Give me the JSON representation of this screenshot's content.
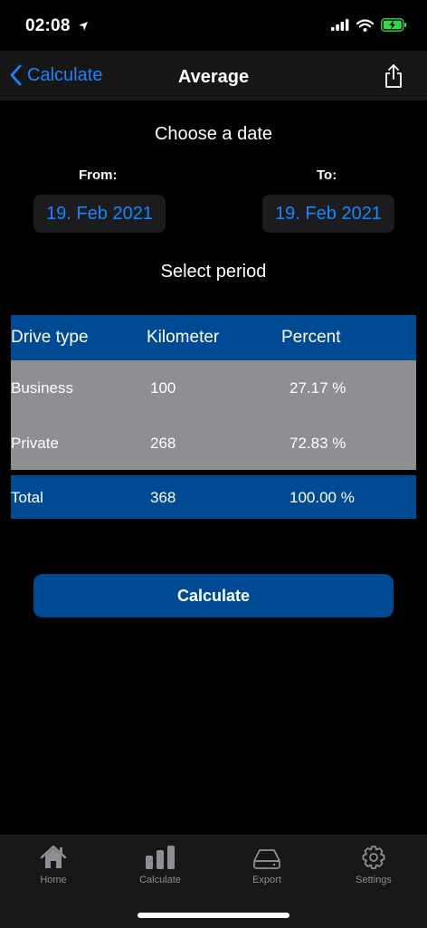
{
  "status": {
    "time": "02:08"
  },
  "nav": {
    "back_label": "Calculate",
    "title": "Average"
  },
  "date_section": {
    "title": "Choose a date",
    "from_label": "From:",
    "to_label": "To:",
    "from_value": "19. Feb 2021",
    "to_value": "19. Feb 2021"
  },
  "period_label": "Select period",
  "table": {
    "headers": [
      "Drive type",
      "Kilometer",
      "Percent"
    ],
    "rows": [
      [
        "Business",
        "100",
        "27.17 %"
      ],
      [
        "Private",
        "268",
        "72.83 %"
      ]
    ],
    "total": [
      "Total",
      "368",
      "100.00 %"
    ]
  },
  "calculate_label": "Calculate",
  "tabs": [
    {
      "label": "Home",
      "icon": "home-icon"
    },
    {
      "label": "Calculate",
      "icon": "bar-chart-icon"
    },
    {
      "label": "Export",
      "icon": "drive-icon"
    },
    {
      "label": "Settings",
      "icon": "gear-icon"
    }
  ],
  "colors": {
    "accent": "#1a84ff",
    "brand": "#004a94",
    "row_bg": "#8e8e93",
    "battery": "#32d74b"
  }
}
